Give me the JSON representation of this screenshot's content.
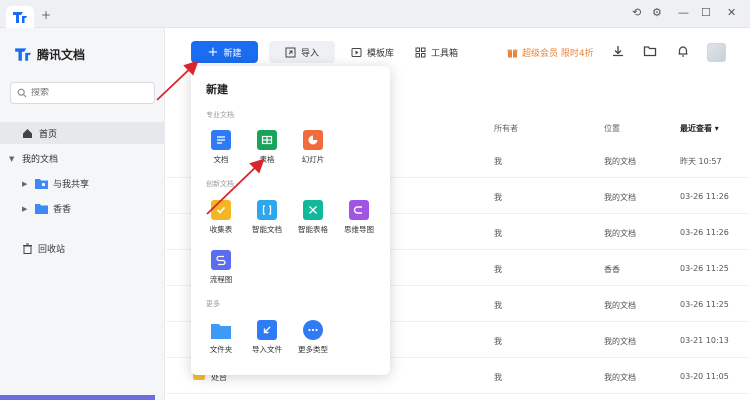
{
  "app": {
    "brand_name": "腾讯文档",
    "window_controls": [
      "sync-icon",
      "settings-icon",
      "minimize-icon",
      "maximize-icon",
      "close-icon"
    ]
  },
  "sidebar": {
    "search_placeholder": "搜索",
    "home": "首页",
    "my_docs": "我的文档",
    "shared": "与我共享",
    "folder": "香香",
    "trash": "回收站"
  },
  "toolbar": {
    "new_label": "新建",
    "import_label": "导入",
    "templates_label": "模板库",
    "tools_label": "工具箱",
    "vip_label": "超级会员 限时4折"
  },
  "table": {
    "headers": {
      "owner": "所有者",
      "location": "位置",
      "recent": "最近查看 ▾"
    },
    "rows": [
      {
        "name": "",
        "owner": "我",
        "location": "我的文档",
        "time": "昨天 10:57"
      },
      {
        "name": "",
        "owner": "我",
        "location": "我的文档",
        "time": "03-26 11:26"
      },
      {
        "name": "",
        "owner": "我",
        "location": "我的文档",
        "time": "03-26 11:26"
      },
      {
        "name": "",
        "owner": "我",
        "location": "香香",
        "time": "03-26 11:25"
      },
      {
        "name": "",
        "owner": "我",
        "location": "我的文档",
        "time": "03-26 11:25"
      },
      {
        "name": "",
        "owner": "我",
        "location": "我的文档",
        "time": "03-21 10:13"
      },
      {
        "name": "处台",
        "owner": "我",
        "location": "我的文档",
        "time": "03-20 11:05"
      }
    ]
  },
  "dropdown": {
    "title": "新建",
    "section_pro": "专业文档",
    "section_creative": "创新文档",
    "section_more": "更多",
    "pro_items": [
      "文档",
      "表格",
      "幻灯片"
    ],
    "creative_items": [
      "收集表",
      "智能文档",
      "智能表格",
      "思维导图",
      "流程图"
    ],
    "more_items": [
      "文件夹",
      "导入文件",
      "更多类型"
    ]
  },
  "colors": {
    "accent": "#1a6cf0",
    "vip": "#e8833a",
    "folder": "#f7c034",
    "annotation_arrow": "#d9262c"
  }
}
